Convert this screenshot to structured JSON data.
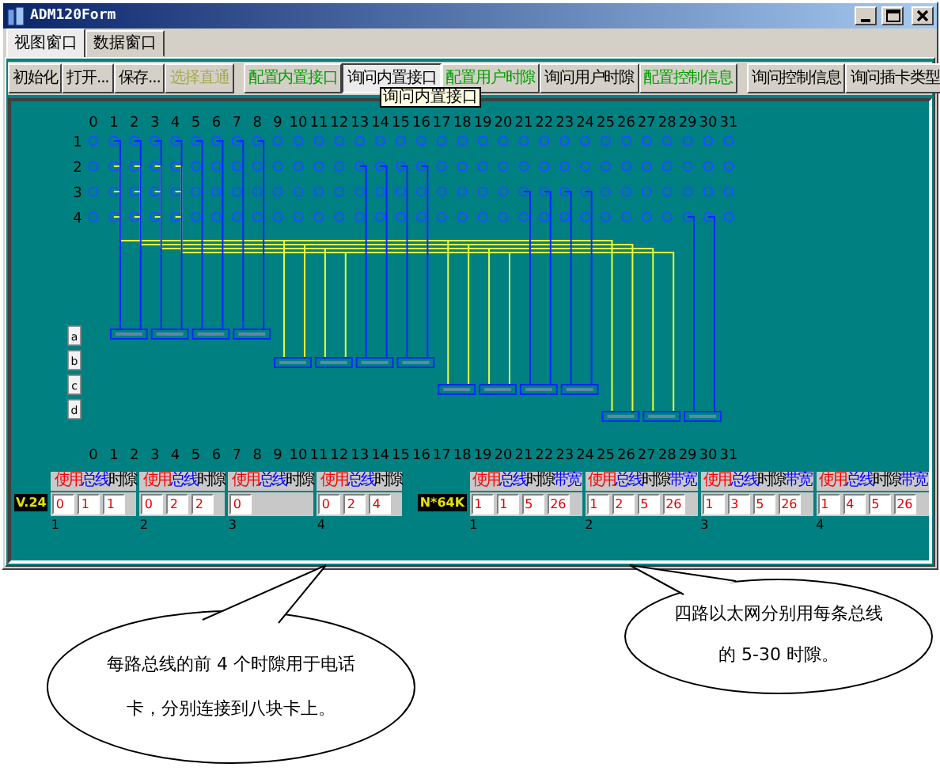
{
  "window": {
    "title": "ADM120Form"
  },
  "tabs": [
    {
      "label": "视图窗口",
      "selected": true
    },
    {
      "label": "数据窗口",
      "selected": false
    }
  ],
  "toolbar": [
    [
      {
        "label": "初始化",
        "kind": "action",
        "disabled": false,
        "selected": false
      },
      {
        "label": "打开...",
        "kind": "action",
        "disabled": false,
        "selected": false
      },
      {
        "label": "保存...",
        "kind": "action",
        "disabled": false,
        "selected": false
      },
      {
        "label": "选择直通",
        "kind": "action",
        "disabled": true,
        "selected": false
      }
    ],
    [
      {
        "label": "配置内置接口",
        "kind": "config",
        "disabled": false,
        "selected": false
      },
      {
        "label": "询问内置接口",
        "kind": "action",
        "disabled": false,
        "selected": true
      },
      {
        "label": "配置用户时隙",
        "kind": "config",
        "disabled": false,
        "selected": false
      },
      {
        "label": "询问用户时隙",
        "kind": "action",
        "disabled": false,
        "selected": false
      },
      {
        "label": "配置控制信息",
        "kind": "config",
        "disabled": false,
        "selected": false
      }
    ],
    [
      {
        "label": "询问控制信息",
        "kind": "action",
        "disabled": false,
        "selected": false
      },
      {
        "label": "询问插卡类型",
        "kind": "action",
        "disabled": false,
        "selected": false
      }
    ]
  ],
  "tooltip": "询问内置接口",
  "matrix": {
    "top_columns": [
      "0",
      "1",
      "2",
      "3",
      "4",
      "5",
      "6",
      "7",
      "8",
      "9",
      "10",
      "11",
      "12",
      "13",
      "14",
      "15",
      "16",
      "17",
      "18",
      "19",
      "20",
      "21",
      "22",
      "23",
      "24",
      "25",
      "26",
      "27",
      "28",
      "29",
      "30",
      "31"
    ],
    "rows": [
      "1",
      "2",
      "3",
      "4"
    ],
    "side_buttons": [
      "a",
      "b",
      "c",
      "d"
    ],
    "bottom_columns": [
      "0",
      "1",
      "2",
      "3",
      "4",
      "5",
      "6",
      "7",
      "8",
      "9",
      "10",
      "11",
      "12",
      "13",
      "14",
      "15",
      "16",
      "17",
      "18",
      "19",
      "20",
      "21",
      "22",
      "23",
      "24",
      "25",
      "26",
      "27",
      "28",
      "29",
      "30",
      "31"
    ]
  },
  "v24": {
    "label": "V.24",
    "groups": [
      {
        "number": "1",
        "header": [
          {
            "text": "使用",
            "color": "#ff0000"
          },
          {
            "text": "总线",
            "color": "#0000ff"
          },
          {
            "text": "时隙",
            "color": "#000000"
          }
        ],
        "fields": [
          "0",
          "1",
          "1"
        ]
      },
      {
        "number": "2",
        "header": [
          {
            "text": "使用",
            "color": "#ff0000"
          },
          {
            "text": "总线",
            "color": "#0000ff"
          },
          {
            "text": "时隙",
            "color": "#000000"
          }
        ],
        "fields": [
          "0",
          "2",
          "2"
        ]
      },
      {
        "number": "3",
        "header": [
          {
            "text": "使用",
            "color": "#ff0000"
          },
          {
            "text": "总线",
            "color": "#0000ff"
          },
          {
            "text": "时隙",
            "color": "#000000"
          }
        ],
        "fields": [
          "0"
        ]
      },
      {
        "number": "4",
        "header": [
          {
            "text": "使用",
            "color": "#ff0000"
          },
          {
            "text": "总线",
            "color": "#0000ff"
          },
          {
            "text": "时隙",
            "color": "#000000"
          }
        ],
        "fields": [
          "0",
          "2",
          "4"
        ]
      }
    ]
  },
  "n64k": {
    "label": "N*64K",
    "groups": [
      {
        "number": "1",
        "header": [
          {
            "text": "使用",
            "color": "#ff0000"
          },
          {
            "text": "总线",
            "color": "#0000ff"
          },
          {
            "text": "时隙",
            "color": "#000000"
          },
          {
            "text": "带宽",
            "color": "#0000ff"
          }
        ],
        "fields": [
          "1",
          "1",
          "5",
          "26"
        ]
      },
      {
        "number": "2",
        "header": [
          {
            "text": "使用",
            "color": "#ff0000"
          },
          {
            "text": "总线",
            "color": "#0000ff"
          },
          {
            "text": "时隙",
            "color": "#000000"
          },
          {
            "text": "带宽",
            "color": "#0000ff"
          }
        ],
        "fields": [
          "1",
          "2",
          "5",
          "26"
        ]
      },
      {
        "number": "3",
        "header": [
          {
            "text": "使用",
            "color": "#ff0000"
          },
          {
            "text": "总线",
            "color": "#0000ff"
          },
          {
            "text": "时隙",
            "color": "#000000"
          },
          {
            "text": "带宽",
            "color": "#0000ff"
          }
        ],
        "fields": [
          "1",
          "3",
          "5",
          "26"
        ]
      },
      {
        "number": "4",
        "header": [
          {
            "text": "使用",
            "color": "#ff0000"
          },
          {
            "text": "总线",
            "color": "#0000ff"
          },
          {
            "text": "时隙",
            "color": "#000000"
          },
          {
            "text": "带宽",
            "color": "#0000ff"
          }
        ],
        "fields": [
          "1",
          "4",
          "5",
          "26"
        ]
      }
    ]
  },
  "callouts": [
    {
      "text": "每路总线的前 4 个时隙用于电话卡，分别连接到八块卡上。"
    },
    {
      "text": "四路以太网分别用每条总线的 5-30 时隙。"
    }
  ]
}
